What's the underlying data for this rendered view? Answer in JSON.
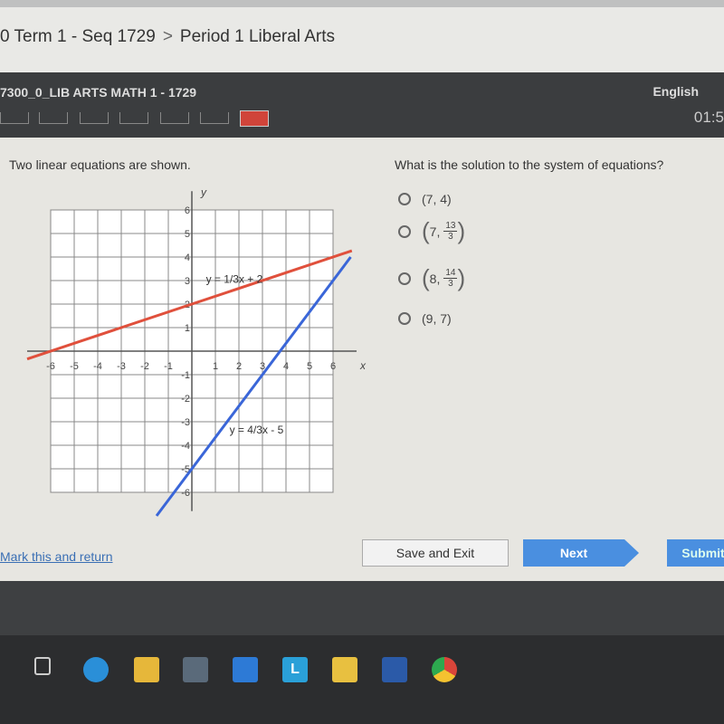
{
  "breadcrumb": {
    "items": [
      "0 Term 1 - Seq 1729",
      "Period 1 Liberal Arts"
    ],
    "separator": ">"
  },
  "header": {
    "course": "7300_0_LIB ARTS MATH 1 - 1729",
    "language": "English",
    "timer": "01:5"
  },
  "question": {
    "prompt": "Two linear equations are shown.",
    "question": "What is the solution to the system of equations?",
    "options": [
      {
        "label": "(7, 4)"
      },
      {
        "whole": "7,",
        "num": "13",
        "den": "3"
      },
      {
        "whole": "8,",
        "num": "14",
        "den": "3"
      },
      {
        "label": "(9, 7)"
      }
    ]
  },
  "graph": {
    "x_axis_label": "x",
    "y_axis_label": "y",
    "x_ticks": [
      "-6",
      "-5",
      "-4",
      "-3",
      "-2",
      "-1",
      "1",
      "2",
      "3",
      "4",
      "5",
      "6"
    ],
    "y_ticks": [
      "6",
      "5",
      "4",
      "3",
      "2",
      "1",
      "-1",
      "-2",
      "-3",
      "-4",
      "-5",
      "-6"
    ],
    "lines": [
      {
        "label": "y = 1/3x + 2",
        "slope": 0.3333,
        "intercept": 2,
        "color": "#e0503c"
      },
      {
        "label": "y = 4/3x - 5",
        "slope": 1.3333,
        "intercept": -5,
        "color": "#3a66d8"
      }
    ]
  },
  "footer": {
    "mark_label": "Mark this and return",
    "save_label": "Save and Exit",
    "next_label": "Next",
    "submit_label": "Submit"
  },
  "colors": {
    "accent": "#4a8fe0",
    "header": "#3b3d3f"
  }
}
